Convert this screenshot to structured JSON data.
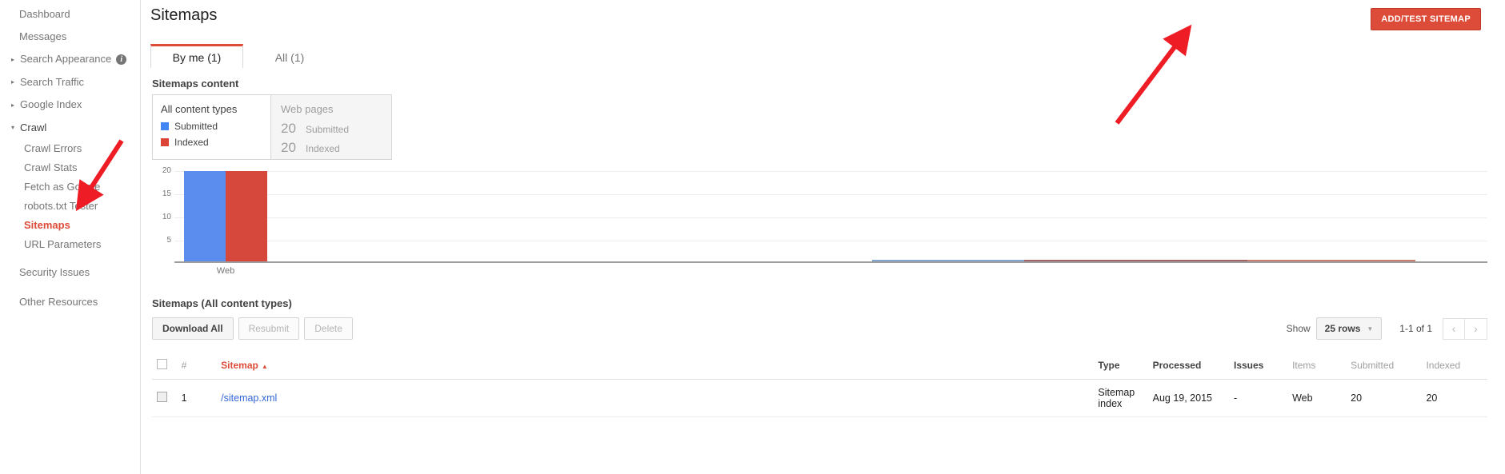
{
  "sidebar": {
    "items": [
      {
        "label": "Dashboard",
        "type": "top"
      },
      {
        "label": "Messages",
        "type": "top"
      },
      {
        "label": "Search Appearance",
        "type": "expandable",
        "caret": "▸",
        "badge": "i"
      },
      {
        "label": "Search Traffic",
        "type": "expandable",
        "caret": "▸"
      },
      {
        "label": "Google Index",
        "type": "expandable",
        "caret": "▸"
      },
      {
        "label": "Crawl",
        "type": "expandable-open",
        "caret": "▾"
      }
    ],
    "crawl_children": [
      {
        "label": "Crawl Errors",
        "active": false
      },
      {
        "label": "Crawl Stats",
        "active": false
      },
      {
        "label": "Fetch as Google",
        "active": false
      },
      {
        "label": "robots.txt Tester",
        "active": false
      },
      {
        "label": "Sitemaps",
        "active": true
      },
      {
        "label": "URL Parameters",
        "active": false
      }
    ],
    "footer_items": [
      {
        "label": "Security Issues"
      },
      {
        "label": "Other Resources"
      }
    ]
  },
  "header": {
    "title": "Sitemaps",
    "add_button": "ADD/TEST SITEMAP"
  },
  "tabs": [
    {
      "label": "By me (1)",
      "active": true
    },
    {
      "label": "All (1)",
      "active": false
    }
  ],
  "content_panel": {
    "section_label": "Sitemaps content",
    "selected_card": {
      "title": "All content types",
      "legend": [
        {
          "label": "Submitted",
          "color": "#4285f4"
        },
        {
          "label": "Indexed",
          "color": "#db4437"
        }
      ]
    },
    "other_card": {
      "title": "Web pages",
      "metrics": [
        {
          "value": "20",
          "label": "Submitted"
        },
        {
          "value": "20",
          "label": "Indexed"
        }
      ]
    }
  },
  "chart_data": {
    "type": "bar",
    "title": "Sitemaps content",
    "categories": [
      "Web"
    ],
    "series": [
      {
        "name": "Submitted",
        "values": [
          20
        ],
        "color": "#5b8def"
      },
      {
        "name": "Indexed",
        "values": [
          20
        ],
        "color": "#d6483b"
      }
    ],
    "xlabel": "",
    "ylabel": "",
    "ylim": [
      0,
      21
    ],
    "yticks": [
      "20",
      "15",
      "10",
      "5"
    ],
    "grid": true,
    "legend_position": "panel-left"
  },
  "table_section": {
    "title": "Sitemaps (All content types)",
    "buttons": [
      {
        "label": "Download All",
        "disabled": false
      },
      {
        "label": "Resubmit",
        "disabled": true
      },
      {
        "label": "Delete",
        "disabled": true
      }
    ],
    "pager": {
      "show_label": "Show",
      "rows_value": "25 rows",
      "range": "1-1 of 1",
      "prev_icon": "‹",
      "next_icon": "›"
    },
    "columns": [
      {
        "key": "check",
        "label": "",
        "muted": false
      },
      {
        "key": "num",
        "label": "#",
        "muted": true
      },
      {
        "key": "sitemap",
        "label": "Sitemap",
        "muted": false,
        "sorted": true,
        "sort_arrow": "▲"
      },
      {
        "key": "type",
        "label": "Type",
        "muted": false
      },
      {
        "key": "processed",
        "label": "Processed",
        "muted": false
      },
      {
        "key": "issues",
        "label": "Issues",
        "muted": false
      },
      {
        "key": "items",
        "label": "Items",
        "muted": true
      },
      {
        "key": "submitted",
        "label": "Submitted",
        "muted": true
      },
      {
        "key": "indexed",
        "label": "Indexed",
        "muted": true
      }
    ],
    "rows": [
      {
        "num": "1",
        "sitemap": "/sitemap.xml",
        "type": "Sitemap index",
        "processed": "Aug 19, 2015",
        "issues": "-",
        "items": "Web",
        "submitted": "20",
        "indexed": "20"
      }
    ]
  },
  "annotations": {
    "arrow_color": "#ee1c25",
    "arrows": [
      {
        "name": "arrow-to-sitemaps-nav"
      },
      {
        "name": "arrow-to-add-test-sitemap"
      }
    ]
  }
}
